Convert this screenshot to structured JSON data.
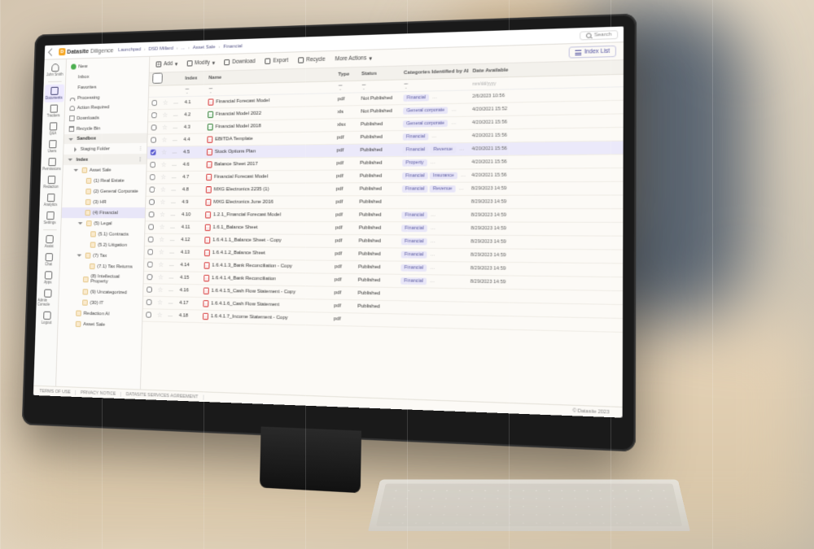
{
  "brand": {
    "bold": "Datasite",
    "light": "Diligence"
  },
  "breadcrumbs": [
    "Launchpad",
    "DSD Millard",
    "...",
    "Asset Sale",
    "Financial"
  ],
  "search_placeholder": "Search",
  "user_name": "John Smith",
  "rail": [
    {
      "label": "Documents",
      "active": true
    },
    {
      "label": "Trackers"
    },
    {
      "label": "Q&A"
    },
    {
      "label": "Users"
    },
    {
      "label": "Permissions"
    },
    {
      "label": "Redaction"
    },
    {
      "label": "Analytics"
    },
    {
      "label": "Settings"
    }
  ],
  "rail2": [
    {
      "label": "Assist"
    },
    {
      "label": "Chat"
    },
    {
      "label": "Apps"
    },
    {
      "label": "Admin Console"
    },
    {
      "label": "Logout"
    }
  ],
  "sidebar": {
    "quick": [
      "New",
      "Inbox",
      "Favorites",
      "Processing",
      "Action Required",
      "Downloads",
      "Recycle Bin"
    ],
    "sandbox_header": "Sandbox",
    "staging": "Staging Folder",
    "index_header": "Index",
    "tree": [
      {
        "label": "Asset Sale",
        "depth": 1,
        "open": true
      },
      {
        "label": "(1) Real Estate",
        "depth": 2
      },
      {
        "label": "(2) General Corporate",
        "depth": 2
      },
      {
        "label": "(3) HR",
        "depth": 2
      },
      {
        "label": "(4) Financial",
        "depth": 2,
        "selected": true
      },
      {
        "label": "(5) Legal",
        "depth": 2,
        "open": true
      },
      {
        "label": "(5.1) Contracts",
        "depth": 3
      },
      {
        "label": "(5.2) Litigation",
        "depth": 3
      },
      {
        "label": "(7) Tax",
        "depth": 2,
        "open": true
      },
      {
        "label": "(7.1) Tax Returns",
        "depth": 3
      },
      {
        "label": "(8) Intellectual Property",
        "depth": 2
      },
      {
        "label": "(9) Uncategorized",
        "depth": 2
      },
      {
        "label": "(30) IT",
        "depth": 2
      },
      {
        "label": "Redaction AI",
        "depth": 1
      },
      {
        "label": "Asset Sale",
        "depth": 1
      }
    ]
  },
  "toolbar": {
    "add": "Add",
    "modify": "Modify",
    "download": "Download",
    "export": "Export",
    "recycle": "Recycle",
    "more": "More Actions",
    "index_list": "Index List"
  },
  "columns": {
    "index": "Index",
    "name": "Name",
    "type": "Type",
    "status": "Status",
    "categories": "Categories Identified by AI",
    "date": "Date Available"
  },
  "date_filter": "mm/dd/yyyy",
  "rows": [
    {
      "idx": "4.1",
      "name": "Financial Forecast Model",
      "type": "pdf",
      "status": "Not Published",
      "cats": [
        "Financial"
      ],
      "date": "2/6/2023 10:56"
    },
    {
      "idx": "4.2",
      "name": "Financial Model 2022",
      "type": "xls",
      "status": "Not Published",
      "cats": [
        "General corporate"
      ],
      "date": "4/20/2021 15:52"
    },
    {
      "idx": "4.3",
      "name": "Financial Model 2018",
      "type": "xlsx",
      "status": "Published",
      "cats": [
        "General corporate"
      ],
      "date": "4/20/2021 15:56"
    },
    {
      "idx": "4.4",
      "name": "EBITDA Template",
      "type": "pdf",
      "status": "Published",
      "cats": [
        "Financial"
      ],
      "date": "4/20/2021 15:56"
    },
    {
      "idx": "4.5",
      "name": "Stock Options Plan",
      "type": "pdf",
      "status": "Published",
      "cats": [
        "Financial",
        "Revenue"
      ],
      "date": "4/20/2021 15:56",
      "selected": true
    },
    {
      "idx": "4.6",
      "name": "Balance Sheet 2017",
      "type": "pdf",
      "status": "Published",
      "cats": [
        "Property"
      ],
      "date": "4/20/2021 15:56"
    },
    {
      "idx": "4.7",
      "name": "Financial Forecast Model",
      "type": "pdf",
      "status": "Published",
      "cats": [
        "Financial",
        "Insurance"
      ],
      "date": "4/20/2021 15:56"
    },
    {
      "idx": "4.8",
      "name": "MXG Electronics 2235 (1)",
      "type": "pdf",
      "status": "Published",
      "cats": [
        "Financial",
        "Revenue"
      ],
      "date": "8/29/2023 14:59"
    },
    {
      "idx": "4.9",
      "name": "MXG Electronics June 2016",
      "type": "pdf",
      "status": "Published",
      "cats": [],
      "date": "8/29/2023 14:59"
    },
    {
      "idx": "4.10",
      "name": "1.2.1_Financial Forecast Model",
      "type": "pdf",
      "status": "Published",
      "cats": [
        "Financial"
      ],
      "date": "8/29/2023 14:59"
    },
    {
      "idx": "4.11",
      "name": "1.6.1_Balance Sheet",
      "type": "pdf",
      "status": "Published",
      "cats": [
        "Financial"
      ],
      "date": "8/29/2023 14:59"
    },
    {
      "idx": "4.12",
      "name": "1.6.4.1.1_Balance Sheet - Copy",
      "type": "pdf",
      "status": "Published",
      "cats": [
        "Financial"
      ],
      "date": "8/29/2023 14:59"
    },
    {
      "idx": "4.13",
      "name": "1.6.4.1.2_Balance Sheet",
      "type": "pdf",
      "status": "Published",
      "cats": [
        "Financial"
      ],
      "date": "8/29/2023 14:59"
    },
    {
      "idx": "4.14",
      "name": "1.6.4.1.3_Bank Reconciliation - Copy",
      "type": "pdf",
      "status": "Published",
      "cats": [
        "Financial"
      ],
      "date": "8/29/2023 14:59"
    },
    {
      "idx": "4.15",
      "name": "1.6.4.1.4_Bank Reconciliation",
      "type": "pdf",
      "status": "Published",
      "cats": [
        "Financial"
      ],
      "date": "8/29/2023 14:59"
    },
    {
      "idx": "4.16",
      "name": "1.6.4.1.5_Cash Flow Statement - Copy",
      "type": "pdf",
      "status": "Published",
      "cats": [],
      "date": ""
    },
    {
      "idx": "4.17",
      "name": "1.6.4.1.6_Cash Flow Statement",
      "type": "pdf",
      "status": "Published",
      "cats": [],
      "date": ""
    },
    {
      "idx": "4.18",
      "name": "1.6.4.1.7_Income Statement - Copy",
      "type": "pdf",
      "status": "",
      "cats": [],
      "date": ""
    }
  ],
  "footer": [
    "TERMS OF USE",
    "PRIVACY NOTICE",
    "DATASITE SERVICES AGREEMENT"
  ],
  "copyright": "© Datasite 2023"
}
